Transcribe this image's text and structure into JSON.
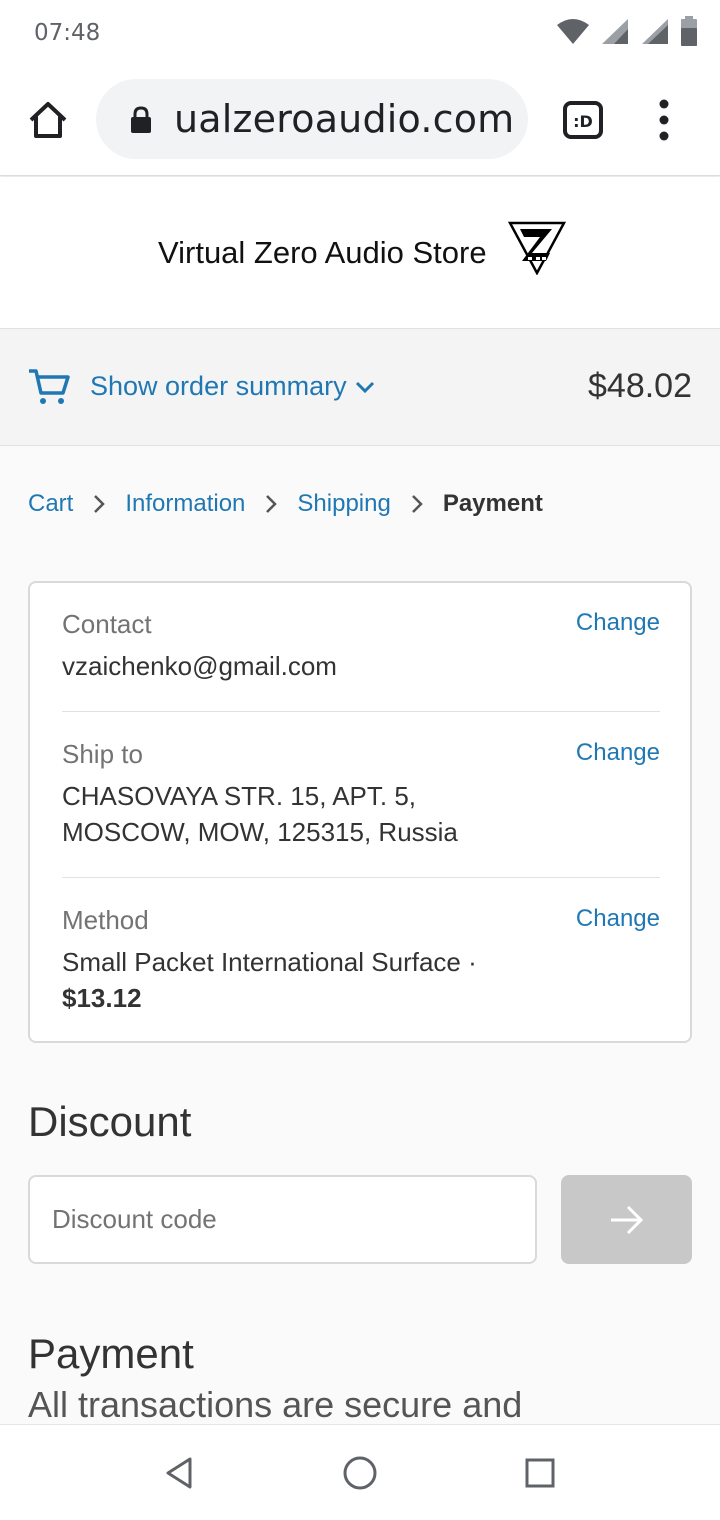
{
  "status_bar": {
    "time": "07:48"
  },
  "browser": {
    "url": "ualzeroaudio.com",
    "tab_icon_label": ":D"
  },
  "store": {
    "title": "Virtual Zero Audio Store"
  },
  "order_summary": {
    "toggle_label": "Show order summary",
    "total": "$48.02"
  },
  "breadcrumb": {
    "items": [
      "Cart",
      "Information",
      "Shipping",
      "Payment"
    ],
    "current": "Payment"
  },
  "review": {
    "contact": {
      "label": "Contact",
      "value": "vzaichenko@gmail.com",
      "change": "Change"
    },
    "ship_to": {
      "label": "Ship to",
      "line1": "CHASOVAYA STR. 15, APT. 5,",
      "line2": "MOSCOW, MOW, 125315, Russia",
      "change": "Change"
    },
    "method": {
      "label": "Method",
      "name": "Small Packet International Surface ·",
      "price": "$13.12",
      "change": "Change"
    }
  },
  "discount": {
    "title": "Discount",
    "placeholder": "Discount code"
  },
  "payment": {
    "title": "Payment",
    "subtitle": "All transactions are secure and"
  },
  "colors": {
    "link": "#1f78b4",
    "disabled_button": "#c8c8c8"
  },
  "icons": [
    "wifi-icon",
    "signal-icon",
    "battery-icon",
    "home-icon",
    "lock-icon",
    "tab-switcher-icon",
    "more-icon",
    "cart-icon",
    "chevron-down-icon",
    "chevron-right-icon",
    "arrow-right-icon",
    "back-icon",
    "home-circle-icon",
    "recents-icon"
  ]
}
